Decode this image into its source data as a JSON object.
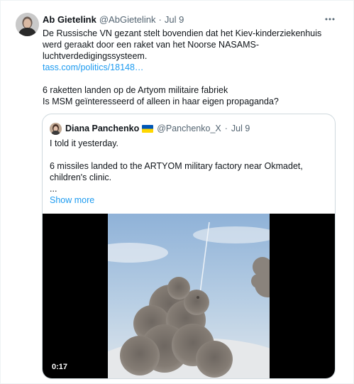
{
  "tweet": {
    "author_name": "Ab Gietelink",
    "author_handle": "@AbGietelink",
    "separator": "·",
    "time": "Jul 9",
    "lines": [
      "De Russische VN gezant stelt bovendien dat het Kiev-kinderziekenhuis",
      "werd geraakt door een raket van het Noorse NASAMS-",
      "luchtverdedigingssysteem."
    ],
    "link": "tass.com/politics/18148…",
    "lines2": [
      "6 raketten landen op de Artyom militaire fabriek",
      "Is MSM geïnteresseerd of alleen in haar eigen propaganda?"
    ]
  },
  "quote": {
    "author_name": "Diana Panchenko",
    "author_handle": "@Panchenko_X",
    "separator": "·",
    "time": "Jul 9",
    "line1": "I told it yesterday.",
    "line2": "6 missiles landed to the ARTYOM military factory near Okmadet,",
    "line3": "children's clinic.",
    "ellipsis": "...",
    "show_more": "Show more",
    "video_duration": "0:17"
  },
  "icons": {
    "more": "more-horizontal-icon",
    "flag": "ukraine-flag-icon"
  },
  "colors": {
    "link": "#1d9bf0",
    "secondary_text": "#536471",
    "border": "#cfd9de",
    "flag_blue": "#0057b7",
    "flag_yellow": "#ffd700"
  }
}
